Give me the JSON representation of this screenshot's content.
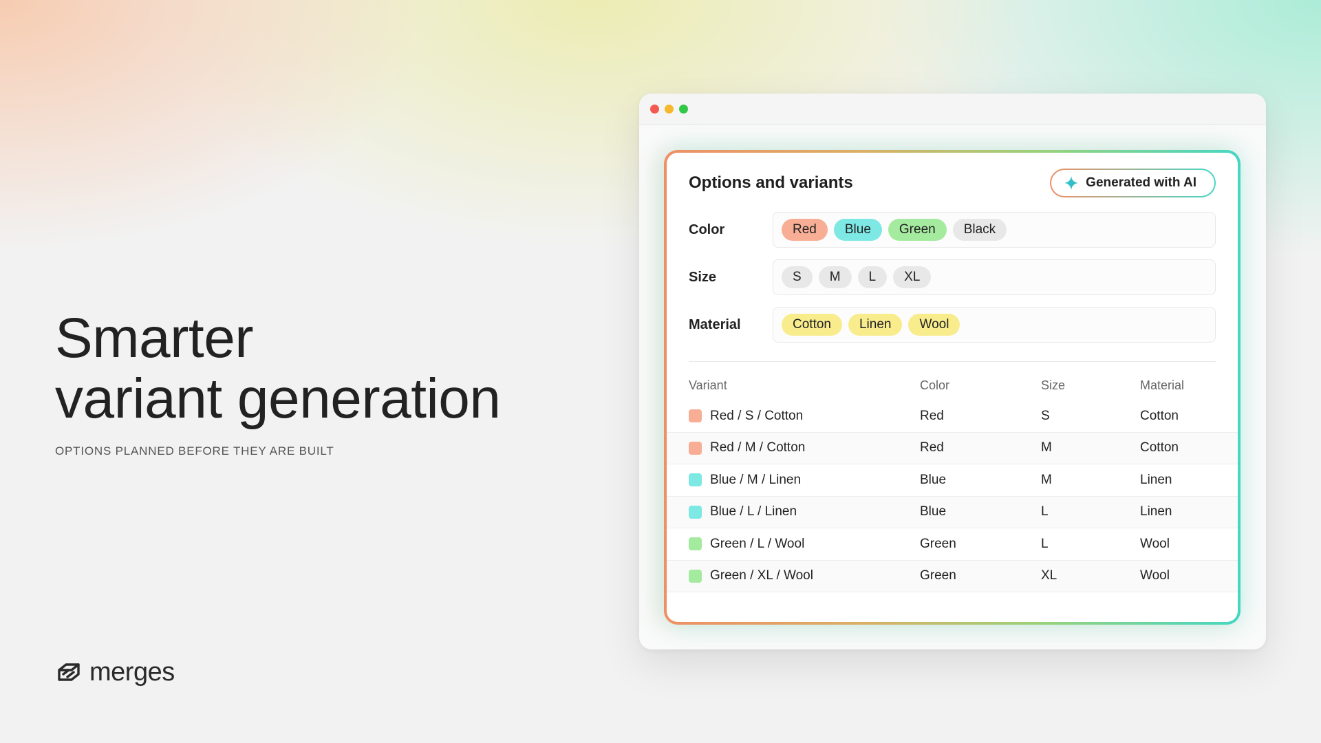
{
  "hero": {
    "title_line1": "Smarter",
    "title_line2": "variant generation",
    "subtitle": "OPTIONS PLANNED BEFORE THEY ARE BUILT"
  },
  "brand": {
    "name": "merges",
    "logo_icon": "merges-logo-icon"
  },
  "window": {
    "controls": [
      "close",
      "minimize",
      "maximize"
    ]
  },
  "panel": {
    "title": "Options and variants",
    "ai_badge": {
      "label": "Generated with AI",
      "icon": "sparkle-icon"
    },
    "options": [
      {
        "label": "Color",
        "values": [
          "Red",
          "Blue",
          "Green",
          "Black"
        ]
      },
      {
        "label": "Size",
        "values": [
          "S",
          "M",
          "L",
          "XL"
        ]
      },
      {
        "label": "Material",
        "values": [
          "Cotton",
          "Linen",
          "Wool"
        ]
      }
    ],
    "table": {
      "headers": [
        "Variant",
        "Color",
        "Size",
        "Material"
      ],
      "rows": [
        {
          "variant": "Red / S / Cotton",
          "color": "Red",
          "size": "S",
          "material": "Cotton"
        },
        {
          "variant": "Red / M / Cotton",
          "color": "Red",
          "size": "M",
          "material": "Cotton"
        },
        {
          "variant": "Blue / M / Linen",
          "color": "Blue",
          "size": "M",
          "material": "Linen"
        },
        {
          "variant": "Blue / L / Linen",
          "color": "Blue",
          "size": "L",
          "material": "Linen"
        },
        {
          "variant": "Green / L / Wool",
          "color": "Green",
          "size": "L",
          "material": "Wool"
        },
        {
          "variant": "Green / XL / Wool",
          "color": "Green",
          "size": "XL",
          "material": "Wool"
        }
      ]
    }
  },
  "colors": {
    "red_chip": "#f8ae94",
    "blue_chip": "#7de8e4",
    "green_chip": "#a5eb9f",
    "grey_chip": "#e8e8e8",
    "yellow_chip": "#f8ec8d",
    "gradient_start": "#ee9066",
    "gradient_end": "#45d6c4"
  }
}
